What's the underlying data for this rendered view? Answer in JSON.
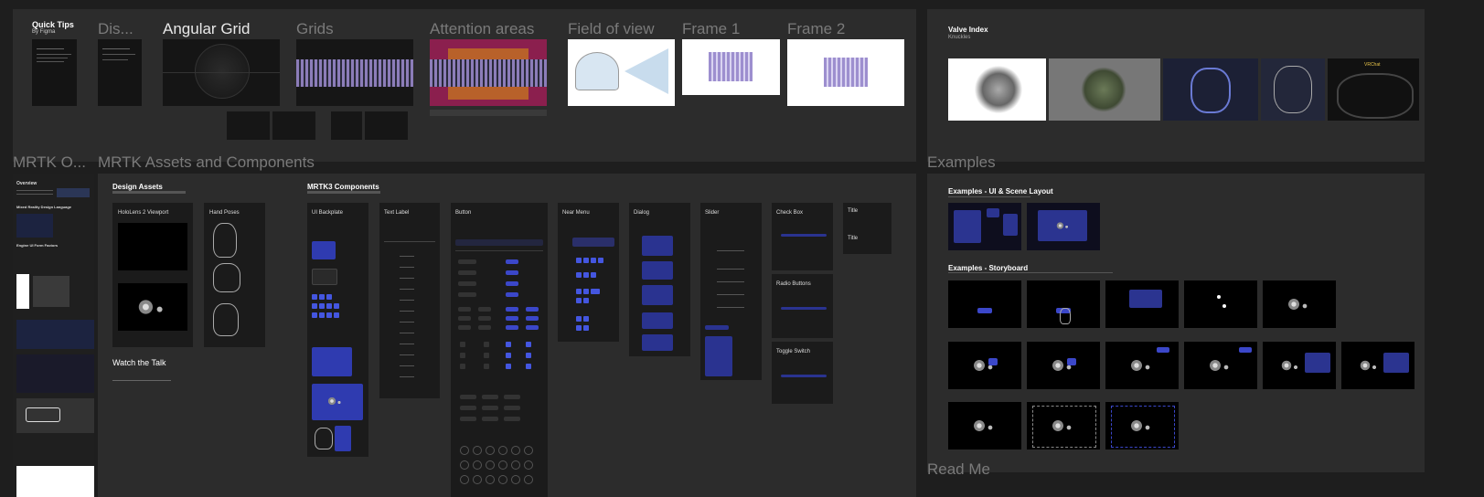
{
  "sections": {
    "top_left": {
      "quick_tips": {
        "title": "Quick Tips",
        "subtitle": "By Figma"
      },
      "frames": [
        {
          "title": "Dis..."
        },
        {
          "title": "Angular Grid"
        },
        {
          "title": "Grids"
        },
        {
          "title": "Attention areas"
        },
        {
          "title": "Field of view"
        },
        {
          "title": "Frame 1"
        },
        {
          "title": "Frame 2"
        }
      ]
    },
    "valve_index": {
      "title": "Valve Index",
      "subtitle": "Knuckles"
    },
    "mrtk_overview": {
      "title": "MRTK O...",
      "items": [
        "Overview",
        "Mixed Reality Design Language",
        "Engine UI Form Factors",
        "Button"
      ]
    },
    "mrtk_assets": {
      "title": "MRTK Assets and Components",
      "design_assets": {
        "title": "Design Assets",
        "cards": [
          "HoloLens 2 Viewport",
          "Hand Poses"
        ]
      },
      "watch_talk": {
        "title": "Watch the Talk"
      },
      "mrtk3_components": {
        "title": "MRTK3 Components",
        "cards": [
          "UI Backplate",
          "Text Label",
          "Button",
          "Near Menu",
          "Dialog",
          "Slider",
          "Check Box",
          "Title"
        ],
        "extra_cards": [
          "Radio Buttons",
          "Toggle Switch",
          "Title"
        ]
      }
    },
    "examples": {
      "title": "Examples",
      "ui_layout": {
        "title": "Examples - UI & Scene Layout"
      },
      "storyboard": {
        "title": "Examples - Storyboard"
      }
    },
    "read_me": {
      "title": "Read Me"
    }
  },
  "colors": {
    "canvas": "#1e1e1e",
    "section": "#2c2c2c",
    "accent": "#3b47c9",
    "purple": "#9d8fcf"
  }
}
